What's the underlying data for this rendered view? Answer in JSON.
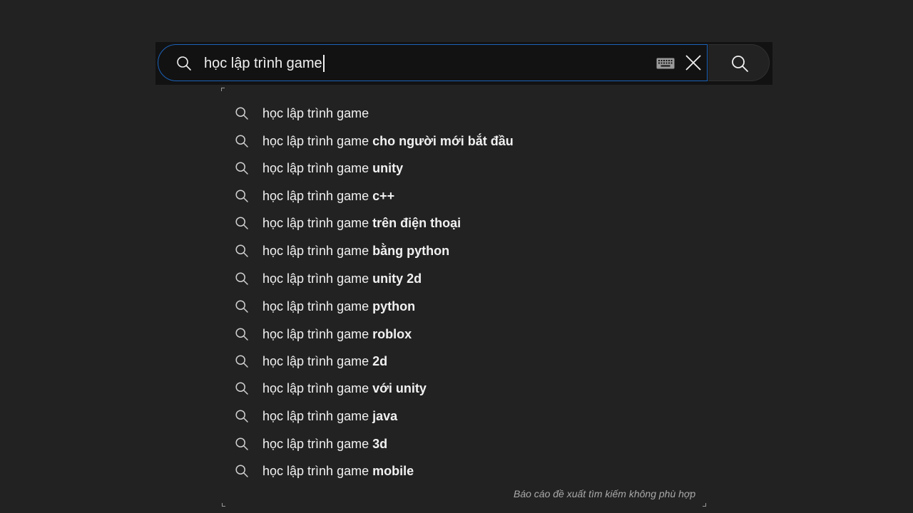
{
  "search": {
    "query": "học lập trình game",
    "placeholder": "",
    "lead_icon": "search-icon",
    "keyboard_icon": "keyboard-icon",
    "clear_icon": "close-icon",
    "submit_icon": "search-icon"
  },
  "suggestions": [
    {
      "prefix": "học lập trình game",
      "completion": ""
    },
    {
      "prefix": "học lập trình game",
      "completion": "cho người mới bắt đầu"
    },
    {
      "prefix": "học lập trình game",
      "completion": "unity"
    },
    {
      "prefix": "học lập trình game",
      "completion": "c++"
    },
    {
      "prefix": "học lập trình game",
      "completion": "trên điện thoại"
    },
    {
      "prefix": "học lập trình game",
      "completion": "bằng python"
    },
    {
      "prefix": "học lập trình game",
      "completion": "unity 2d"
    },
    {
      "prefix": "học lập trình game",
      "completion": "python"
    },
    {
      "prefix": "học lập trình game",
      "completion": "roblox"
    },
    {
      "prefix": "học lập trình game",
      "completion": "2d"
    },
    {
      "prefix": "học lập trình game",
      "completion": "với unity"
    },
    {
      "prefix": "học lập trình game",
      "completion": "java"
    },
    {
      "prefix": "học lập trình game",
      "completion": "3d"
    },
    {
      "prefix": "học lập trình game",
      "completion": "mobile"
    }
  ],
  "report_link": "Báo cáo đề xuất tìm kiếm không phù hợp",
  "colors": {
    "background": "#222222",
    "search_bg": "#121212",
    "focus_border": "#1c62b9",
    "text": "#f1f1f1",
    "muted": "#aaaaaa"
  }
}
